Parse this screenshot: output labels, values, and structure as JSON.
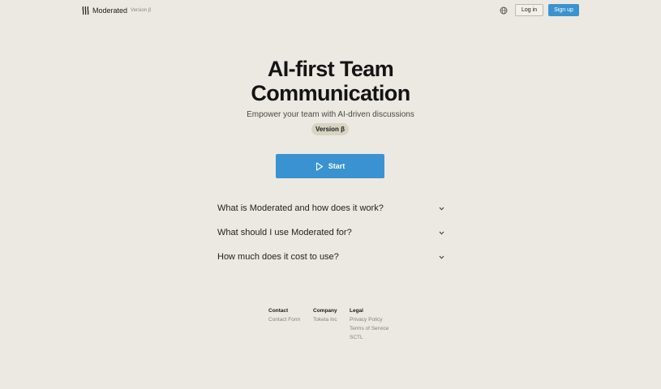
{
  "header": {
    "brand_name": "Moderated",
    "version_label": "Version β",
    "login_label": "Log in",
    "signup_label": "Sign up",
    "icons": {
      "logo": "wave-lines-logo",
      "language": "globe-icon"
    }
  },
  "hero": {
    "title_line1": "AI-first Team",
    "title_line2": "Communication",
    "subtitle": "Empower your team with AI-driven discussions",
    "badge": "Version β",
    "start_label": "Start"
  },
  "faq": [
    {
      "question": "What is Moderated and how does it work?"
    },
    {
      "question": "What should I use Moderated for?"
    },
    {
      "question": "How much does it cost to use?"
    }
  ],
  "footer": {
    "contact": {
      "heading": "Contact",
      "links": [
        "Contact Form"
      ]
    },
    "company": {
      "heading": "Company",
      "links": [
        "Toketa Inc"
      ]
    },
    "legal": {
      "heading": "Legal",
      "links": [
        "Privacy Policy",
        "Terms of Service",
        "SCTL"
      ]
    }
  },
  "colors": {
    "background": "#ece9e2",
    "accent": "#3a93d0",
    "badge_bg": "#d9d4c2"
  }
}
